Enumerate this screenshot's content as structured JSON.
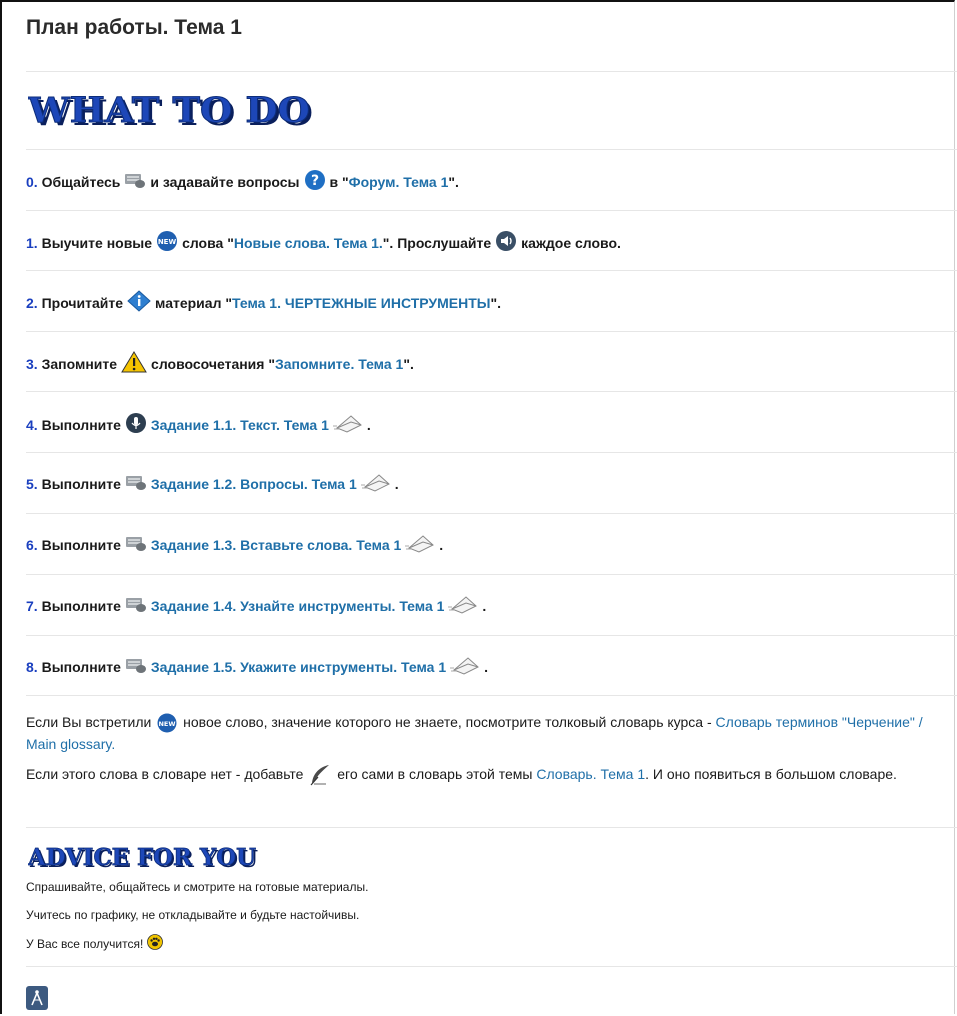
{
  "title": "План работы. Тема 1",
  "banners": {
    "what_to_do": "WHAT TO DO",
    "advice": "ADVICE FOR YOU"
  },
  "steps": [
    {
      "num": "0.",
      "pre": "Общайтесь",
      "icon1": "keyboard-mouse-icon",
      "mid": "и задавайте вопросы",
      "icon2": "question-icon",
      "post1": "в \"",
      "link": "Форум. Тема 1",
      "post2": "\"."
    },
    {
      "num": "1.",
      "pre": "Выучите новые",
      "icon1": "new-badge-icon",
      "mid": "слова \"",
      "link": "Новые слова. Тема 1.",
      "post1": "\". Прослушайте",
      "icon2": "speaker-icon",
      "post2": "каждое слово."
    },
    {
      "num": "2.",
      "pre": "Прочитайте",
      "icon1": "info-diamond-icon",
      "mid": "материал \"",
      "link": "Тема 1. ЧЕРТЕЖНЫЕ ИНСТРУМЕНТЫ",
      "post1": "\"."
    },
    {
      "num": "3.",
      "pre": "Запомните",
      "icon1": "warning-icon",
      "mid": "словосочетания \"",
      "link": "Запомните. Тема 1",
      "post1": "\"."
    },
    {
      "num": "4.",
      "pre": "Выполните",
      "icon1": "microphone-icon",
      "link": "Задание 1.1. Текст. Тема 1",
      "icon2": "envelope-icon",
      "post1": "."
    },
    {
      "num": "5.",
      "pre": "Выполните",
      "icon1": "keyboard-mouse-icon",
      "link": "Задание 1.2. Вопросы. Тема 1",
      "icon2": "envelope-icon",
      "post1": "."
    },
    {
      "num": "6.",
      "pre": "Выполните",
      "icon1": "keyboard-mouse-icon",
      "link": "Задание 1.3. Вставьте слова. Тема 1",
      "icon2": "envelope-icon",
      "post1": "."
    },
    {
      "num": "7.",
      "pre": "Выполните",
      "icon1": "keyboard-mouse-icon",
      "link": "Задание 1.4. Узнайте инструменты. Тема 1",
      "icon2": "envelope-icon",
      "post1": "."
    },
    {
      "num": "8.",
      "pre": "Выполните",
      "icon1": "keyboard-mouse-icon",
      "link": "Задание 1.5. Укажите инструменты. Тема 1",
      "icon2": "envelope-icon",
      "post1": "."
    }
  ],
  "glossary": {
    "p1_a": "Если Вы встретили",
    "p1_b": "новое слово, значение которого не знаете, посмотрите толковый словарь курса -",
    "p1_link": "Словарь терминов \"Черчение\" / Main glossary.",
    "p2_a": "Если этого слова в словаре нет - добавьте",
    "p2_b": "его сами в словарь этой темы",
    "p2_link": "Словарь. Тема 1",
    "p2_c": ". И оно появиться в большом словаре."
  },
  "advice": {
    "line1": "Спрашивайте, общайтесь и смотрите на готовые материалы.",
    "line2": "Учитесь по графику, не откладывайте и будьте настойчивы.",
    "line3": "У Вас все получится!"
  },
  "colors": {
    "link": "#1f6fa8",
    "number": "#1a3fbf",
    "banner_fill": "#1d47b8"
  }
}
